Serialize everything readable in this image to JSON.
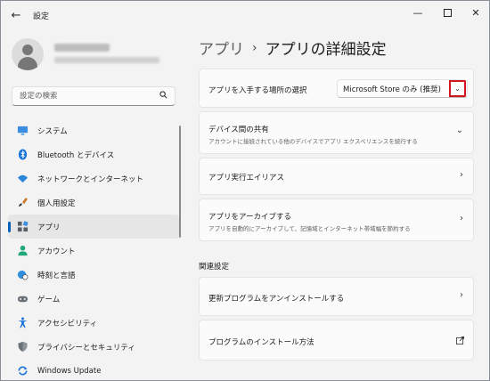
{
  "window": {
    "title": "設定",
    "controls": [
      "minimize",
      "maximize",
      "close"
    ]
  },
  "search": {
    "placeholder": "設定の検索"
  },
  "nav": {
    "items": [
      {
        "label": "システム",
        "icon": "monitor-icon"
      },
      {
        "label": "Bluetooth とデバイス",
        "icon": "bluetooth-icon"
      },
      {
        "label": "ネットワークとインターネット",
        "icon": "wifi-icon"
      },
      {
        "label": "個人用設定",
        "icon": "brush-icon"
      },
      {
        "label": "アプリ",
        "icon": "apps-icon",
        "selected": true
      },
      {
        "label": "アカウント",
        "icon": "person-icon"
      },
      {
        "label": "時刻と言語",
        "icon": "globe-clock-icon"
      },
      {
        "label": "ゲーム",
        "icon": "gamepad-icon"
      },
      {
        "label": "アクセシビリティ",
        "icon": "accessibility-icon"
      },
      {
        "label": "プライバシーとセキュリティ",
        "icon": "shield-icon"
      },
      {
        "label": "Windows Update",
        "icon": "update-icon"
      }
    ]
  },
  "main": {
    "breadcrumb": {
      "parent": "アプリ",
      "separator": "›",
      "current": "アプリの詳細設定"
    },
    "cards": {
      "source": {
        "title": "アプリを入手する場所の選択",
        "dropdown_value": "Microsoft Store のみ (推奨)"
      },
      "share": {
        "title": "デバイス間の共有",
        "desc": "アカウントに接続されている他のデバイスでアプリ エクスペリエンスを続行する"
      },
      "alias": {
        "title": "アプリ実行エイリアス"
      },
      "archive": {
        "title": "アプリをアーカイブする",
        "desc": "アプリを自動的にアーカイブして、記憶域とインターネット帯域幅を節約する"
      }
    },
    "related": {
      "heading": "関連設定",
      "uninstall": {
        "title": "更新プログラムをアンインストールする"
      },
      "install": {
        "title": "プログラムのインストール方法"
      }
    }
  },
  "colors": {
    "accent": "#005fb8",
    "highlight_box": "#d2161e",
    "window_bg": "#f3f3f3",
    "card_bg": "#fbfbfb"
  }
}
